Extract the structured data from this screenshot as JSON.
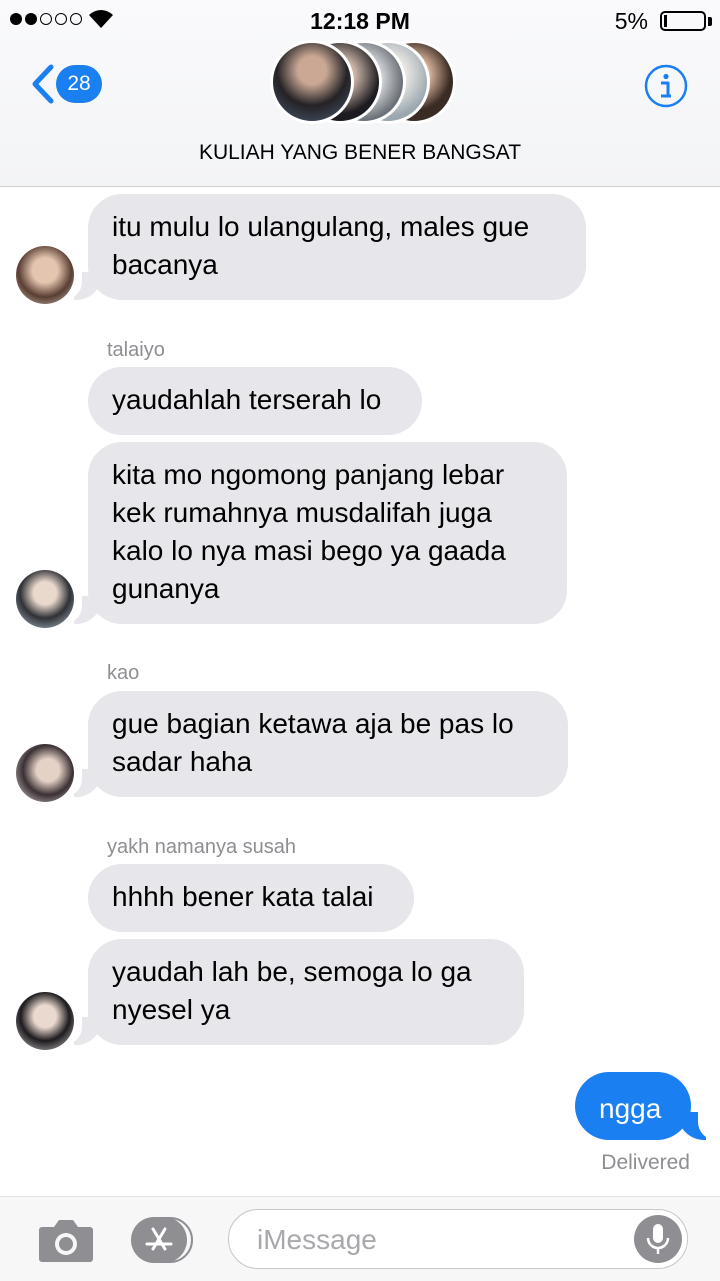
{
  "status_bar": {
    "time": "12:18 PM",
    "battery": "5%",
    "signal_bars_filled": 2,
    "signal_bars_total": 5
  },
  "header": {
    "back_badge": "28",
    "title": "KULIAH YANG BENER BANGSAT",
    "info_icon": "info-icon",
    "back_icon": "chevron-left-icon"
  },
  "colors": {
    "accent": "#1a7ff0",
    "bubble_gray": "#e6e6eb",
    "secondary_text": "#8e8e93"
  },
  "messages": [
    {
      "direction": "incoming",
      "sender": "",
      "text": "itu mulu lo ulangulang, males gue bacanya"
    },
    {
      "direction": "incoming",
      "sender": "talaiyo",
      "text": "yaudahlah terserah lo"
    },
    {
      "direction": "incoming",
      "sender": "",
      "text": "kita mo ngomong panjang lebar kek rumahnya musdalifah juga kalo lo nya masi bego ya gaada gunanya"
    },
    {
      "direction": "incoming",
      "sender": "kao",
      "text": "gue bagian ketawa aja be pas lo sadar haha"
    },
    {
      "direction": "incoming",
      "sender": "yakh namanya susah",
      "text": "hhhh bener kata talai"
    },
    {
      "direction": "incoming",
      "sender": "",
      "text": "yaudah lah be, semoga lo ga nyesel ya"
    },
    {
      "direction": "outgoing",
      "sender": "",
      "text": "ngga"
    }
  ],
  "delivery_status": "Delivered",
  "input_bar": {
    "placeholder": "iMessage",
    "value": "",
    "camera_icon": "camera-icon",
    "apps_icon": "app-store-icon",
    "mic_icon": "microphone-icon"
  }
}
